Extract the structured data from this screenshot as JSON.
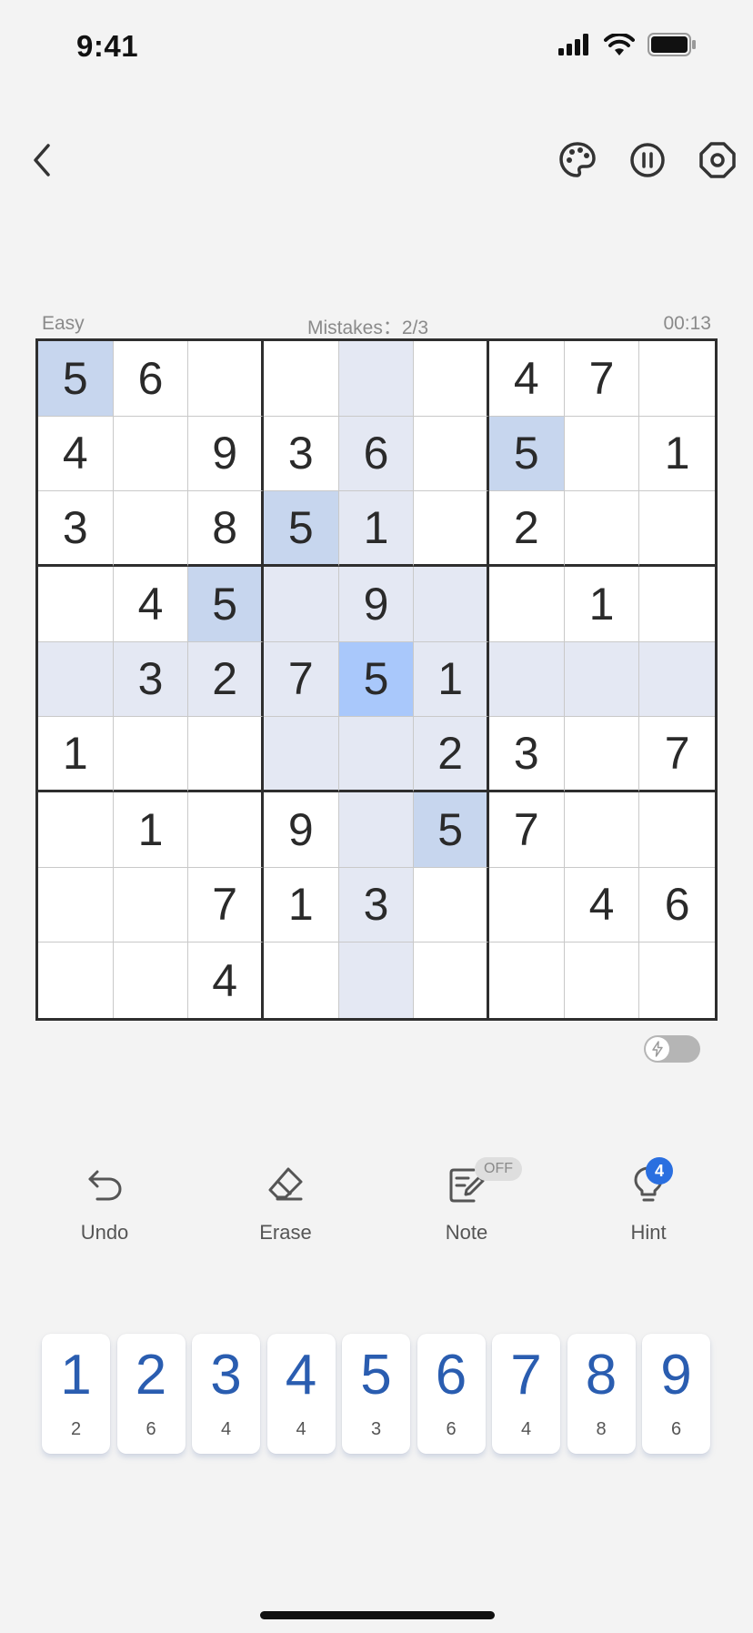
{
  "status_bar": {
    "time": "9:41"
  },
  "game": {
    "difficulty": "Easy",
    "mistakes": "Mistakes：2/3",
    "timer": "00:13"
  },
  "board": {
    "cells": [
      [
        "5",
        "6",
        "",
        "",
        "",
        "",
        "4",
        "7",
        ""
      ],
      [
        "4",
        "",
        "9",
        "3",
        "6",
        "",
        "5",
        "",
        "1"
      ],
      [
        "3",
        "",
        "8",
        "5",
        "1",
        "",
        "2",
        "",
        ""
      ],
      [
        "",
        "4",
        "5",
        "",
        "9",
        "",
        "",
        "1",
        ""
      ],
      [
        "",
        "3",
        "2",
        "7",
        "5",
        "1",
        "",
        "",
        ""
      ],
      [
        "1",
        "",
        "",
        "",
        "",
        "2",
        "3",
        "",
        "7"
      ],
      [
        "",
        "1",
        "",
        "9",
        "",
        "5",
        "7",
        "",
        ""
      ],
      [
        "",
        "",
        "7",
        "1",
        "3",
        "",
        "",
        "4",
        "6"
      ],
      [
        "",
        "",
        "4",
        "",
        "",
        "",
        "",
        "",
        ""
      ]
    ],
    "selected_cell": [
      4,
      4
    ],
    "selected_value": "5"
  },
  "tools": {
    "undo": "Undo",
    "erase": "Erase",
    "note": "Note",
    "note_state": "OFF",
    "hint": "Hint",
    "hint_count": "4"
  },
  "numpad": [
    {
      "digit": "1",
      "remaining": "2"
    },
    {
      "digit": "2",
      "remaining": "6"
    },
    {
      "digit": "3",
      "remaining": "4"
    },
    {
      "digit": "4",
      "remaining": "4"
    },
    {
      "digit": "5",
      "remaining": "3"
    },
    {
      "digit": "6",
      "remaining": "6"
    },
    {
      "digit": "7",
      "remaining": "4"
    },
    {
      "digit": "8",
      "remaining": "8"
    },
    {
      "digit": "9",
      "remaining": "6"
    }
  ],
  "colors": {
    "accent": "#2a5db0",
    "selected_cell": "#a9c8fb",
    "same_number": "#c7d6ee",
    "highlight_region": "#e4e8f3",
    "hint_badge": "#2a6fe0"
  },
  "icons": {
    "back": "chevron-left-icon",
    "theme": "palette-icon",
    "pause": "pause-icon",
    "settings": "settings-icon",
    "undo": "undo-icon",
    "erase": "eraser-icon",
    "note": "pencil-note-icon",
    "hint": "lightbulb-icon",
    "fast_mode": "lightning-icon"
  }
}
